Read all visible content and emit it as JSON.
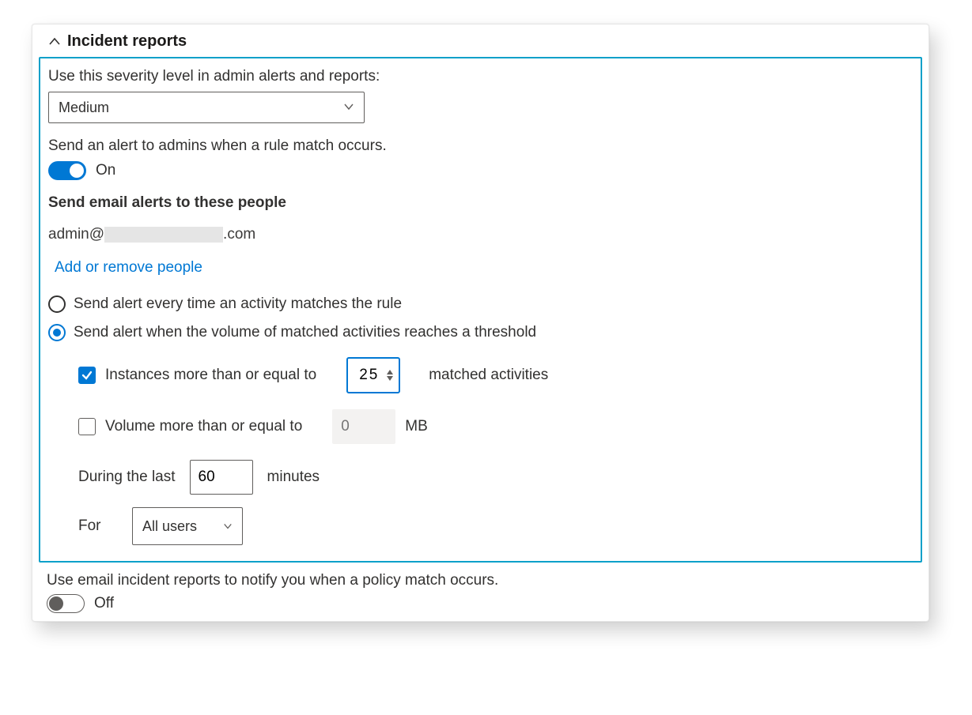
{
  "section": {
    "title": "Incident reports"
  },
  "severity": {
    "label": "Use this severity level in admin alerts and reports:",
    "selected": "Medium"
  },
  "alertToggle": {
    "label": "Send an alert to admins when a rule match occurs.",
    "state": "On"
  },
  "emailAlerts": {
    "label": "Send email alerts to these people",
    "prefix": "admin@",
    "suffix": ".com",
    "addLink": "Add or remove people"
  },
  "alertMode": {
    "optEvery": "Send alert every time an activity matches the rule",
    "optThreshold": "Send alert when the volume of matched activities reaches a threshold"
  },
  "threshold": {
    "instancesLabel": "Instances more than or equal to",
    "instancesValue": "25",
    "instancesSuffix": "matched activities",
    "volumeLabel": "Volume more than or equal to",
    "volumePlaceholder": "0",
    "volumeUnit": "MB",
    "duringLabel": "During the last",
    "duringValue": "60",
    "duringUnit": "minutes",
    "forLabel": "For",
    "forSelected": "All users"
  },
  "incidentEmail": {
    "label": "Use email incident reports to notify you when a policy match occurs.",
    "state": "Off"
  }
}
